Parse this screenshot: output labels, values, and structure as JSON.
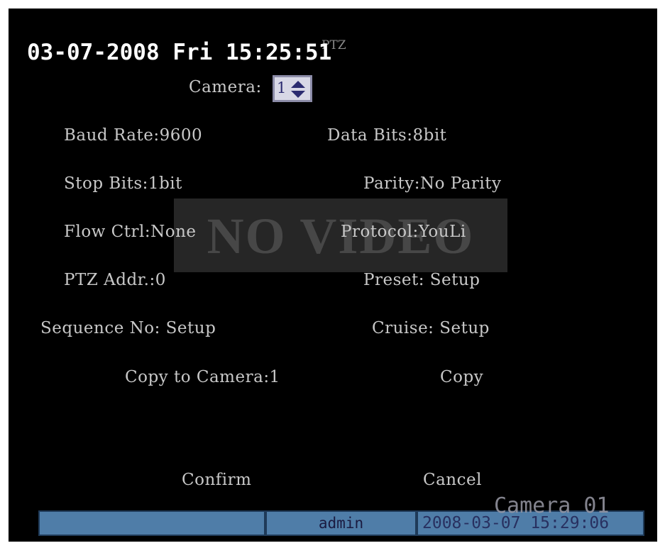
{
  "osd": {
    "datetime": "03-07-2008 Fri 15:25:51",
    "menu_title": "PTZ",
    "camera_label": "Camera:",
    "camera_value": "1",
    "no_video": "NO VIDEO"
  },
  "fields": {
    "baud_rate": "Baud Rate:9600",
    "data_bits": "Data Bits:8bit",
    "stop_bits": "Stop Bits:1bit",
    "parity": "Parity:No Parity",
    "flow_ctrl": "Flow Ctrl:None",
    "protocol": "Protocol:YouLi",
    "ptz_addr": "PTZ Addr.:0",
    "preset": "Preset: Setup",
    "sequence": "Sequence No: Setup",
    "cruise": "Cruise: Setup",
    "copy_to_camera": "Copy to Camera:1",
    "copy": "Copy"
  },
  "actions": {
    "confirm": "Confirm",
    "cancel": "Cancel"
  },
  "status": {
    "user": "admin",
    "timestamp": "2008-03-07 15:29:06",
    "camera_overlay": "Camera 01"
  },
  "colors": {
    "screen_bg": "#000000",
    "osd_text": "#c8c8c8",
    "status_bar": "#4f7da8",
    "spinner_bg": "#d8d8e6"
  }
}
